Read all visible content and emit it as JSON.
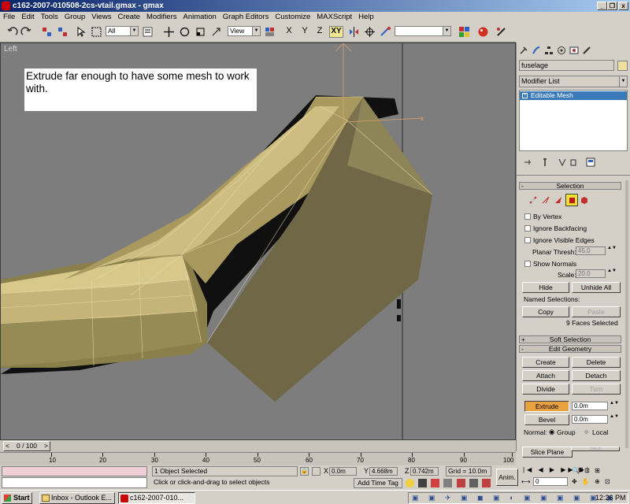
{
  "window": {
    "title": "c162-2007-010508-2cs-vtail.gmax - gmax"
  },
  "menu": [
    "File",
    "Edit",
    "Tools",
    "Group",
    "Views",
    "Create",
    "Modifiers",
    "Animation",
    "Graph Editors",
    "Customize",
    "MAXScript",
    "Help"
  ],
  "toolbar": {
    "selection_filter": "All",
    "ref_coord": "View",
    "axis_xy": "XY",
    "named_set": ""
  },
  "viewport": {
    "label": "Left",
    "annotation": "Extrude far enough to have some mesh to work with."
  },
  "command_panel": {
    "object_name": "fuselage",
    "modifier_list": "Modifier List",
    "stack_item": "Editable Mesh",
    "selection": {
      "title": "Selection",
      "by_vertex": "By Vertex",
      "ignore_backfacing": "Ignore Backfacing",
      "ignore_visible_edges": "Ignore Visible Edges",
      "planar_thresh_label": "Planar Thresh:",
      "planar_thresh_value": "45.0",
      "show_normals": "Show Normals",
      "scale_label": "Scale:",
      "scale_value": "20.0",
      "hide": "Hide",
      "unhide_all": "Unhide All",
      "named_selections": "Named Selections:",
      "copy": "Copy",
      "paste": "Paste",
      "status": "9 Faces Selected"
    },
    "soft_selection": "Soft Selection",
    "edit_geometry": {
      "title": "Edit Geometry",
      "create": "Create",
      "delete": "Delete",
      "attach": "Attach",
      "detach": "Detach",
      "divide": "Divide",
      "turn": "Turn",
      "extrude": "Extrude",
      "extrude_value": "0.0m",
      "bevel": "Bevel",
      "bevel_value": "0.0m",
      "normal_label": "Normal:",
      "group": "Group",
      "local": "Local",
      "slice_plane": "Slice Plane",
      "slice": "Slice"
    }
  },
  "timeline": {
    "frame": "0 / 100",
    "ticks": [
      "10",
      "20",
      "30",
      "40",
      "50",
      "60",
      "70",
      "80",
      "90",
      "100"
    ]
  },
  "status": {
    "selected": "1 Object Selected",
    "prompt": "Click or click-and-drag to select objects",
    "x": "0.0m",
    "y": "4.668m",
    "z": "0.742m",
    "grid": "Grid = 10.0m",
    "add_time_tag": "Add Time Tag",
    "anim": "Anim.",
    "frame_value": "0"
  },
  "taskbar": {
    "start": "Start",
    "task1": "Inbox - Outlook E...",
    "task2": "c162-2007-010...",
    "time": "12:26 PM"
  },
  "colors": {
    "title_start": "#0a246a",
    "title_end": "#a6caf0",
    "viewport_bg": "#7d7d7d",
    "mesh_fill": "#7b7350",
    "extrude_active": "#e8a040",
    "stack_highlight": "#3a7ab8"
  }
}
